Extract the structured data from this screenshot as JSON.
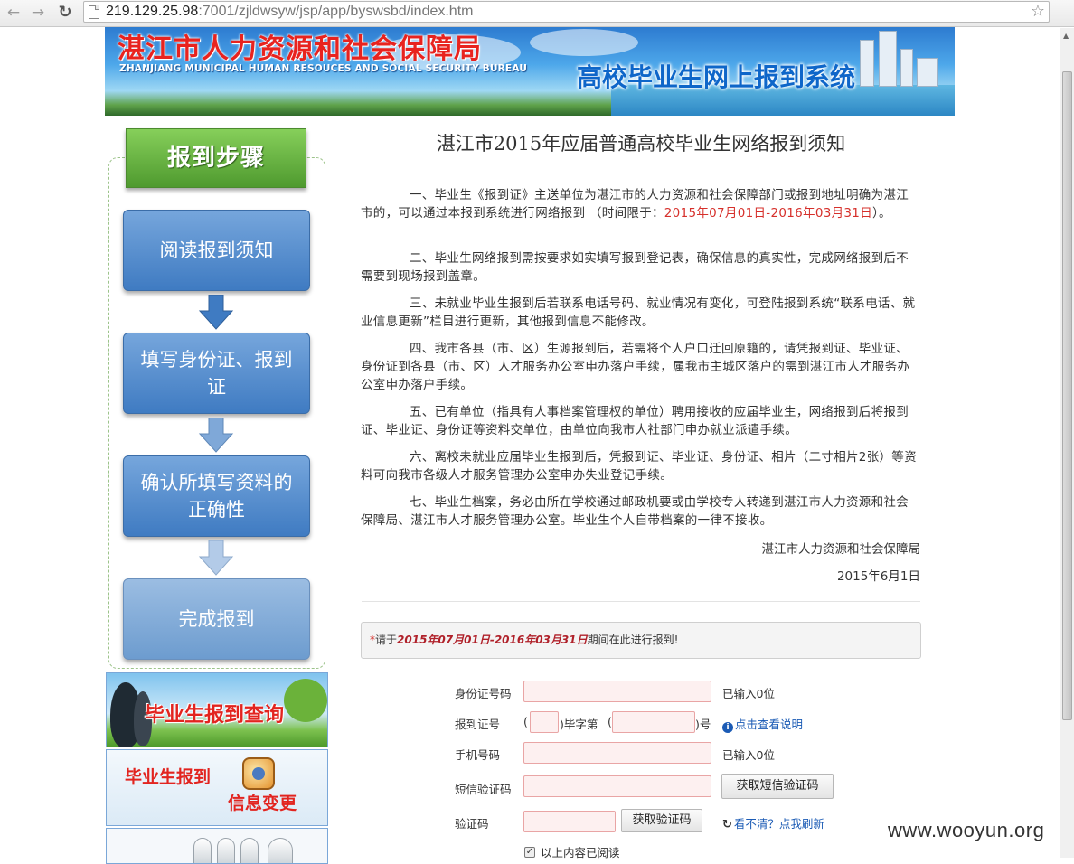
{
  "browser": {
    "url_host": "219.129.25.98",
    "url_path": ":7001/zjldwsyw/jsp/app/byswsbd/index.htm"
  },
  "banner": {
    "title_cn": "湛江市人力资源和社会保障局",
    "title_en": "ZHANJIANG MUNICIPAL HUMAN RESOUCES AND SOCIAL SECURITY BUREAU",
    "system_name": "高校毕业生网上报到系统"
  },
  "sidebar": {
    "header": "报到步骤",
    "steps": [
      {
        "label": "阅读报到须知"
      },
      {
        "label": "填写身份证、报到证"
      },
      {
        "label": "确认所填写资料的正确性"
      },
      {
        "label": "完成报到"
      }
    ],
    "promo_query": "毕业生报到查询",
    "promo_change_1": "毕业生报到",
    "promo_change_2": "信息变更"
  },
  "notice": {
    "title": "湛江市2015年应届普通高校毕业生网络报到须知",
    "p1_a": "一、毕业生《报到证》主送单位为湛江市的人力资源和社会保障部门或报到地址明确为湛江市的，可以通过本报到系统进行网络报到 （时间限于：",
    "p1_red": "2015年07月01日-2016年03月31日",
    "p1_b": "）。",
    "p2": "二、毕业生网络报到需按要求如实填写报到登记表，确保信息的真实性，完成网络报到后不需要到现场报到盖章。",
    "p3": "三、未就业毕业生报到后若联系电话号码、就业情况有变化，可登陆报到系统“联系电话、就业信息更新”栏目进行更新，其他报到信息不能修改。",
    "p4": "四、我市各县（市、区）生源报到后，若需将个人户口迁回原籍的，请凭报到证、毕业证、身份证到各县（市、区）人才服务办公室申办落户手续，属我市主城区落户的需到湛江市人才服务办公室申办落户手续。",
    "p5": "五、已有单位（指具有人事档案管理权的单位）聘用接收的应届毕业生，网络报到后将报到证、毕业证、身份证等资料交单位，由单位向我市人社部门申办就业派遣手续。",
    "p6": "六、离校未就业应届毕业生报到后，凭报到证、毕业证、身份证、相片（二寸相片2张）等资料可向我市各级人才服务管理办公室申办失业登记手续。",
    "p7": "七、毕业生档案，务必由所在学校通过邮政机要或由学校专人转递到湛江市人力资源和社会保障局、湛江市人才服务管理办公室。毕业生个人自带档案的一律不接收。",
    "signature": "湛江市人力资源和社会保障局",
    "date": "2015年6月1日"
  },
  "period": {
    "star": "*",
    "prefix": "请于",
    "start": "2015年07月01日",
    "dash": "-",
    "end": "2016年03月31日",
    "suffix": "期间在此进行报到!"
  },
  "form": {
    "id_label": "身份证号码",
    "id_counter": "已输入0位",
    "cert_label": "报到证号",
    "cert_open1": "(",
    "cert_mid": ")毕字第",
    "cert_open2": "(",
    "cert_close": ")号",
    "cert_help": "点击查看说明",
    "phone_label": "手机号码",
    "phone_counter": "已输入0位",
    "sms_label": "短信验证码",
    "sms_button": "获取短信验证码",
    "captcha_label": "验证码",
    "captcha_button": "获取验证码",
    "captcha_refresh": "看不清？点我刷新",
    "agree_label": "以上内容已阅读"
  },
  "watermark": "www.wooyun.org",
  "colors": {
    "accent_red": "#d6302b",
    "step_blue": "#3f7bc2",
    "step_green": "#4f9a2f",
    "link_blue": "#1b5bb5"
  }
}
